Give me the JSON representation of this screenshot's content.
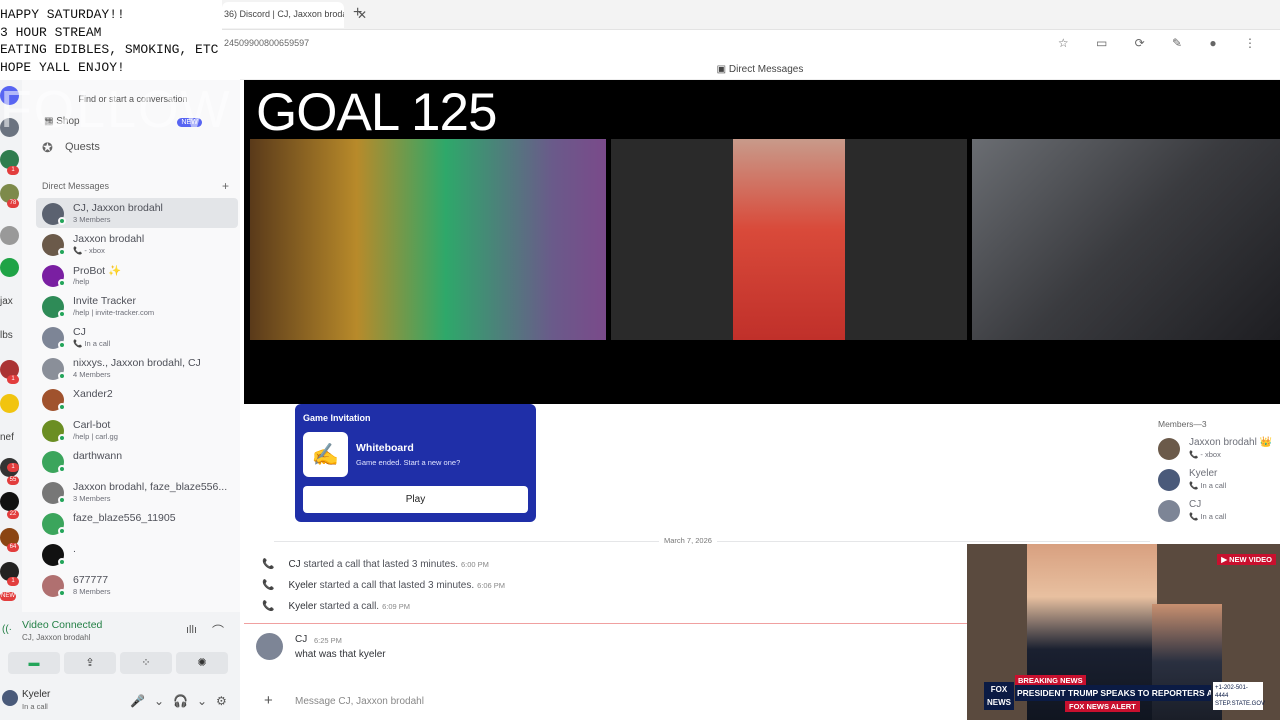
{
  "overlay": {
    "stream_notes": "HAPPY SATURDAY!!\n3 HOUR STREAM\nEATING EDIBLES, SMOKING, ETC\nHOPE YALL ENJOY!",
    "goal": "GOAL 125",
    "follow": "FOLLOW"
  },
  "browser": {
    "tab_title": "36) Discord | CJ, Jaxxon brodahl",
    "tab_close": "✕",
    "new_tab": "+",
    "url_fragment": "24509900800659597"
  },
  "header": {
    "title": "Direct Messages"
  },
  "rail": {
    "badges": [
      "1",
      "78",
      "1",
      "1",
      "55",
      "22",
      "64",
      "1"
    ],
    "labels": [
      "jax",
      "lbs",
      "nef"
    ],
    "new_label": "NEW"
  },
  "sidebar": {
    "search_placeholder": "Find or start a conversation",
    "shop": "Shop",
    "shop_badge": "NEW",
    "quests": "Quests",
    "dm_section": "Direct Messages",
    "dm_plus": "+",
    "items": [
      {
        "name": "CJ, Jaxxon brodahl",
        "sub": "3 Members",
        "color": "#5b6270"
      },
      {
        "name": "Jaxxon brodahl",
        "sub": "📞 - xbox",
        "color": "#6b5a4a"
      },
      {
        "name": "ProBot ✨",
        "sub": "/help",
        "color": "#7a1fa2"
      },
      {
        "name": "Invite Tracker",
        "sub": "/help | invite-tracker.com",
        "color": "#2e8b57"
      },
      {
        "name": "CJ",
        "sub": "📞 In a call",
        "color": "#7d8596"
      },
      {
        "name": "nixxys., Jaxxon brodahl, CJ",
        "sub": "4 Members",
        "color": "#8a8f99"
      },
      {
        "name": "Xander2",
        "sub": "",
        "color": "#a0522d"
      },
      {
        "name": "Carl-bot",
        "sub": "/help | carl.gg",
        "color": "#6b8e23"
      },
      {
        "name": "darthwann",
        "sub": "",
        "color": "#3ba55c"
      },
      {
        "name": "Jaxxon brodahl, faze_blaze556...",
        "sub": "3 Members",
        "color": "#777"
      },
      {
        "name": "faze_blaze556_11905",
        "sub": "",
        "color": "#3ba55c"
      },
      {
        "name": ".",
        "sub": "",
        "color": "#111"
      },
      {
        "name": "677777",
        "sub": "8 Members",
        "color": "#b07070"
      }
    ]
  },
  "voice": {
    "status": "Video Connected",
    "channel": "CJ, Jaxxon brodahl",
    "signal_icon": "((·",
    "buttons": [
      "▬",
      "⇪",
      "⁘",
      "✺"
    ],
    "user": "Kyeler",
    "user_status": "In a call",
    "ctrls": "🎤⌄🎧⌄⚙"
  },
  "chat": {
    "invite_title": "Game Invitation",
    "game_name": "Whiteboard",
    "game_status": "Game ended. Start a new one?",
    "play_label": "Play",
    "date_divider": "March 7, 2026",
    "calls": [
      {
        "author": "CJ",
        "text": " started a call that lasted 3 minutes.",
        "time": "6:00 PM"
      },
      {
        "author": "Kyeler",
        "text": " started a call that lasted 3 minutes.",
        "time": "6:06 PM"
      },
      {
        "author": "Kyeler",
        "text": " started a call.",
        "time": "6:09 PM"
      }
    ],
    "message": {
      "author": "CJ",
      "time": "6:25 PM",
      "text": "what was that kyeler"
    },
    "composer_placeholder": "Message CJ, Jaxxon brodahl",
    "composer_plus": "+"
  },
  "members": {
    "title": "Members—3",
    "list": [
      {
        "name": "Jaxxon brodahl 👑",
        "sub": "📞 - xbox",
        "color": "#6b5a4a"
      },
      {
        "name": "Kyeler",
        "sub": "📞 In a call",
        "color": "#4a5a7a"
      },
      {
        "name": "CJ",
        "sub": "📞 In a call",
        "color": "#7d8596"
      }
    ]
  },
  "news": {
    "tag": "▶ NEW VIDEO",
    "breaking": "BREAKING NEWS",
    "headline": "PRESIDENT TRUMP SPEAKS TO REPORTERS ABOARD AF1",
    "alert": "FOX NEWS ALERT",
    "logo": "FOX NEWS",
    "ticker": "+1-202-501-4444 STEP.STATE.GOV"
  }
}
